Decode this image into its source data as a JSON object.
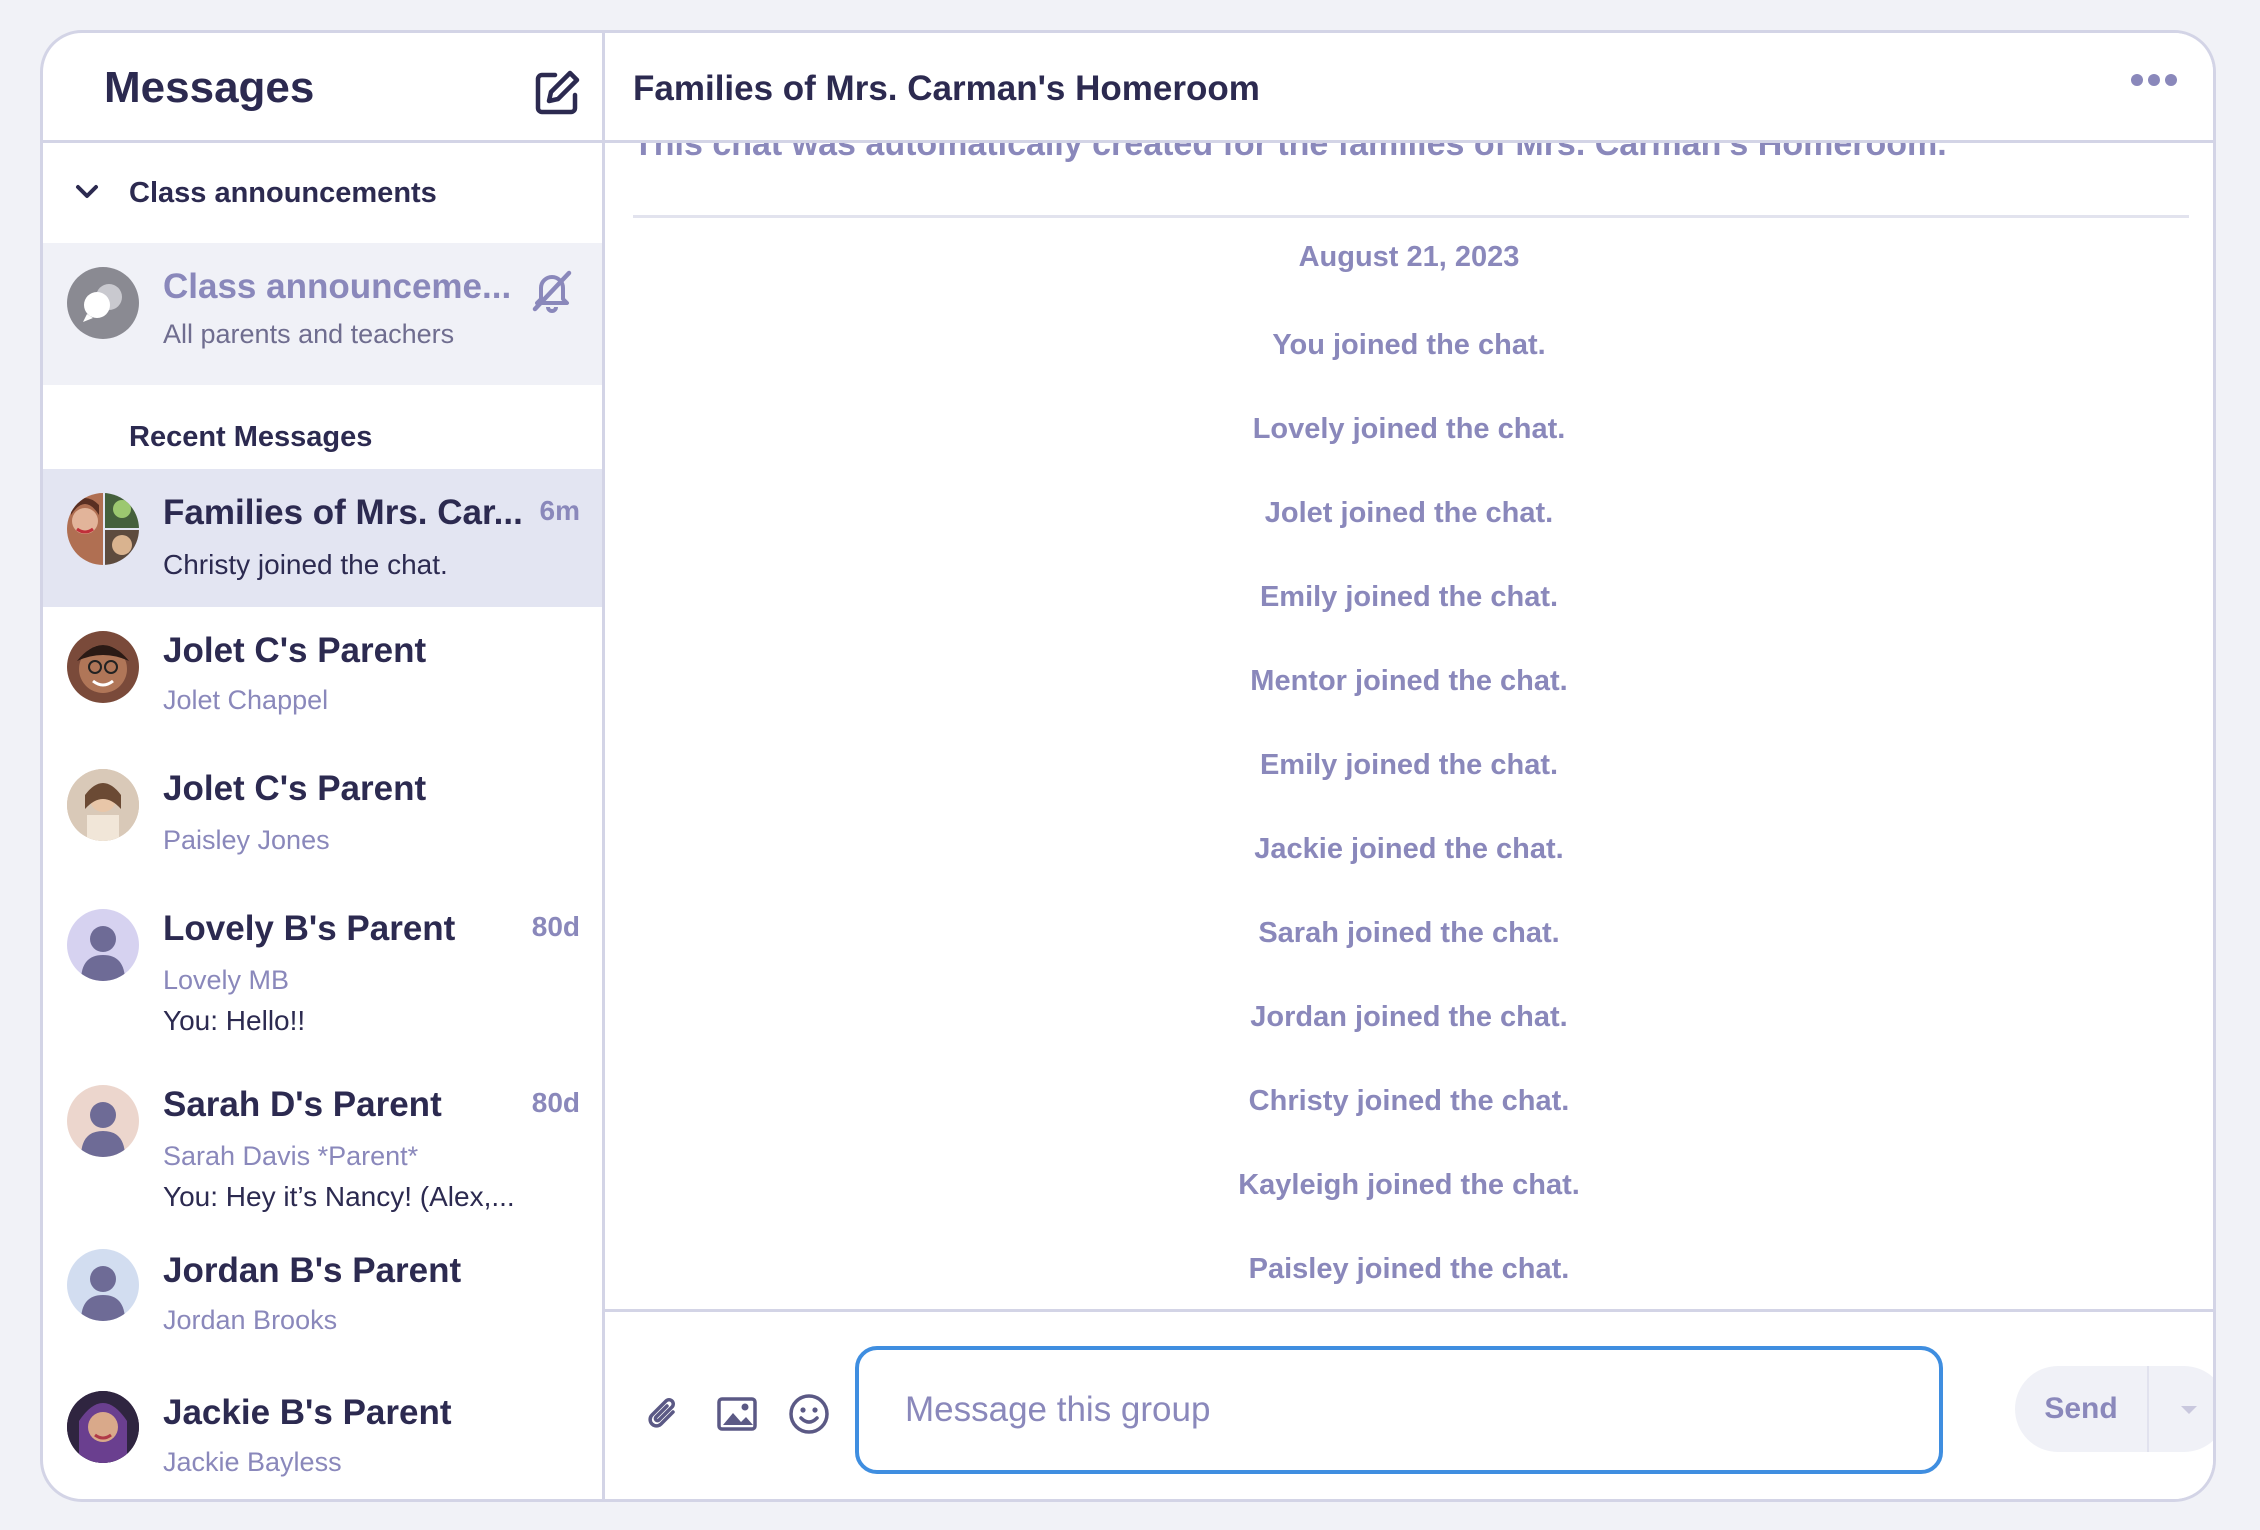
{
  "sidebar": {
    "title": "Messages",
    "section_label": "Class announcements",
    "announcement": {
      "title": "Class announceme...",
      "subtitle": "All parents and teachers"
    },
    "recent_label": "Recent Messages",
    "conversations": [
      {
        "title": "Families of Mrs. Car...",
        "preview": "Christy joined the chat.",
        "time": "6m",
        "active": true
      },
      {
        "title": "Jolet C's Parent",
        "subtitle": "Jolet Chappel"
      },
      {
        "title": "Jolet C's Parent",
        "subtitle": "Paisley Jones"
      },
      {
        "title": "Lovely B's Parent",
        "subtitle": "Lovely MB",
        "preview": "You: Hello!!",
        "time": "80d"
      },
      {
        "title": "Sarah D's Parent",
        "subtitle": "Sarah Davis *Parent*",
        "preview": "You: Hey it’s Nancy! (Alex,...",
        "time": "80d"
      },
      {
        "title": "Jordan B's Parent",
        "subtitle": "Jordan Brooks"
      },
      {
        "title": "Jackie B's Parent",
        "subtitle": "Jackie Bayless"
      }
    ]
  },
  "chat": {
    "title": "Families of Mrs. Carman's Homeroom",
    "auto_note": "This chat was automatically created for the families of Mrs. Carman's Homeroom.",
    "date": "August 21, 2023",
    "events": [
      "You joined the chat.",
      "Lovely joined the chat.",
      "Jolet joined the chat.",
      "Emily joined the chat.",
      "Mentor joined the chat.",
      "Emily joined the chat.",
      "Jackie joined the chat.",
      "Sarah joined the chat.",
      "Jordan joined the chat.",
      "Christy joined the chat.",
      "Kayleigh joined the chat.",
      "Paisley joined the chat."
    ]
  },
  "composer": {
    "placeholder": "Message this group",
    "send_label": "Send"
  },
  "colors": {
    "accent": "#3f8ee0",
    "muted_text": "#8a88bb",
    "primary_text": "#2c2a50",
    "active_row": "#e3e5f2"
  },
  "icons": [
    "compose-icon",
    "chevron-down-icon",
    "mute-icon",
    "more-icon",
    "paperclip-icon",
    "image-icon",
    "emoji-icon",
    "caret-down-icon"
  ]
}
